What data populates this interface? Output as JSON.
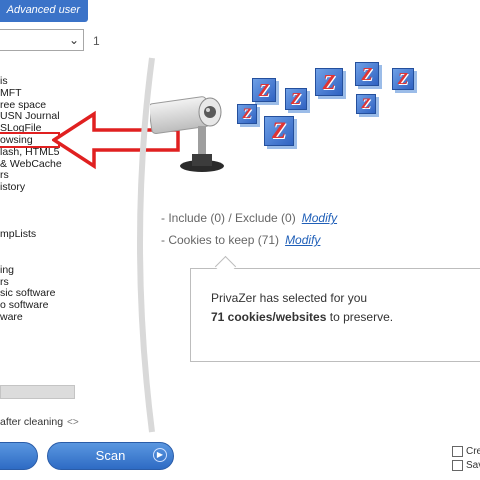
{
  "mode": {
    "label": "Advanced user"
  },
  "selector": {
    "count": "1"
  },
  "left_list": [
    "is",
    "MFT",
    "ree space",
    "USN Journal",
    "SLogFile",
    "owsing",
    "lash, HTML5",
    "& WebCache",
    "rs",
    "istory",
    "",
    "",
    "",
    "mpLists",
    "",
    "",
    "ing",
    "rs",
    "sic software",
    "o software",
    "ware"
  ],
  "options": {
    "after_cleaning": "after cleaning",
    "swap_icon": "<>"
  },
  "buttons": {
    "scan_label": "Scan",
    "scan_icon": "▶"
  },
  "info": {
    "include_exclude": "- Include (0) / Exclude (0)",
    "modify_1": "Modify",
    "cookies_keep": "- Cookies to keep (71)",
    "modify_2": "Modify"
  },
  "bubble": {
    "line1": "PrivaZer has selected for you",
    "bold": "71 cookies/websites",
    "line2_rest": " to preserve."
  },
  "checkboxes": [
    {
      "label": "Cre"
    },
    {
      "label": "Sav"
    }
  ],
  "colors": {
    "accent_blue": "#3b73c8",
    "highlight_red": "#e02020",
    "link_blue": "#1f5fb8"
  },
  "icons": {
    "cube_letter": "Z",
    "camera": "security-camera-icon",
    "arrow": "red-arrow-icon"
  }
}
